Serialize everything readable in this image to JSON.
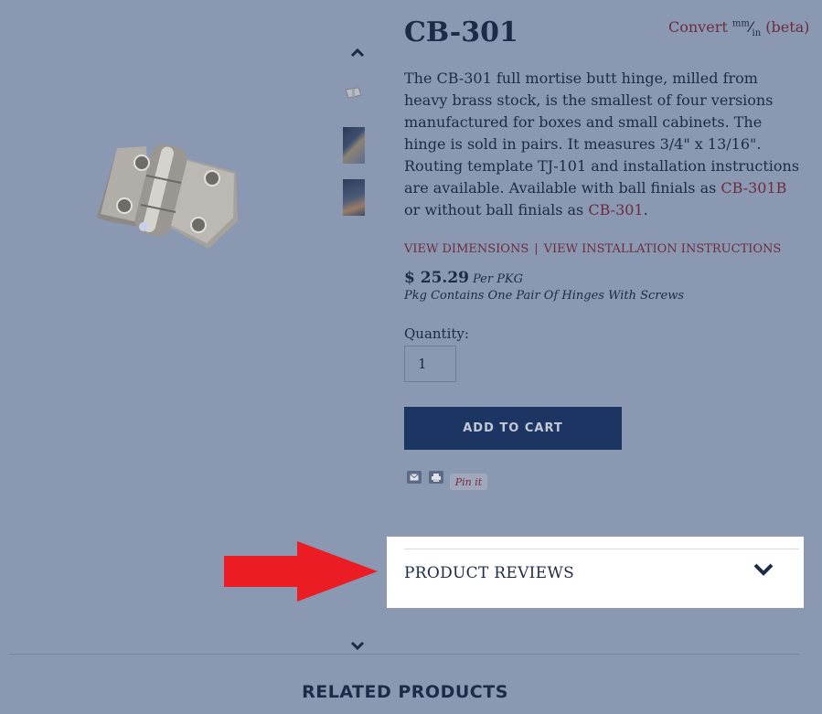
{
  "product": {
    "title": "CB-301",
    "description_1": "The CB-301 full mortise butt hinge, milled from heavy brass stock, is the smallest of four versions manufactured for boxes and small cabinets.  The hinge is sold in pairs. It measures 3/4\" x 13/16\". Routing template TJ-101 and installation instructions are available.  Available with ball finials as ",
    "description_link_1": "CB-301B",
    "description_2": " or without ball finials as ",
    "description_link_2": "CB-301",
    "description_3": "."
  },
  "convert": {
    "label": "Convert",
    "unit_top": "mm",
    "slash": "⁄",
    "unit_bottom": "in",
    "beta": "(beta)"
  },
  "links": {
    "dimensions": "VIEW DIMENSIONS",
    "separator": "|",
    "installation": "VIEW INSTALLATION INSTRUCTIONS"
  },
  "price": {
    "amount": "$ 25.29",
    "per": "Per PKG",
    "package_note": "Pkg Contains One Pair Of Hinges With Screws"
  },
  "quantity": {
    "label": "Quantity:",
    "value": "1"
  },
  "cart": {
    "button_label": "ADD TO CART"
  },
  "share": {
    "email_icon": "email-icon",
    "print_icon": "print-icon",
    "pinit_label": "Pin it"
  },
  "reviews": {
    "title": "PRODUCT REVIEWS",
    "toggle_icon": "chevron-down-icon"
  },
  "related": {
    "title": "RELATED PRODUCTS"
  },
  "colors": {
    "overlay_bg": "#8a98b1",
    "text_navy": "#1d2b47",
    "link_maroon": "#6b2d3e",
    "button_navy": "#1c3562",
    "annotation_arrow": "#ec1c24",
    "highlight_panel": "#ffffff"
  }
}
